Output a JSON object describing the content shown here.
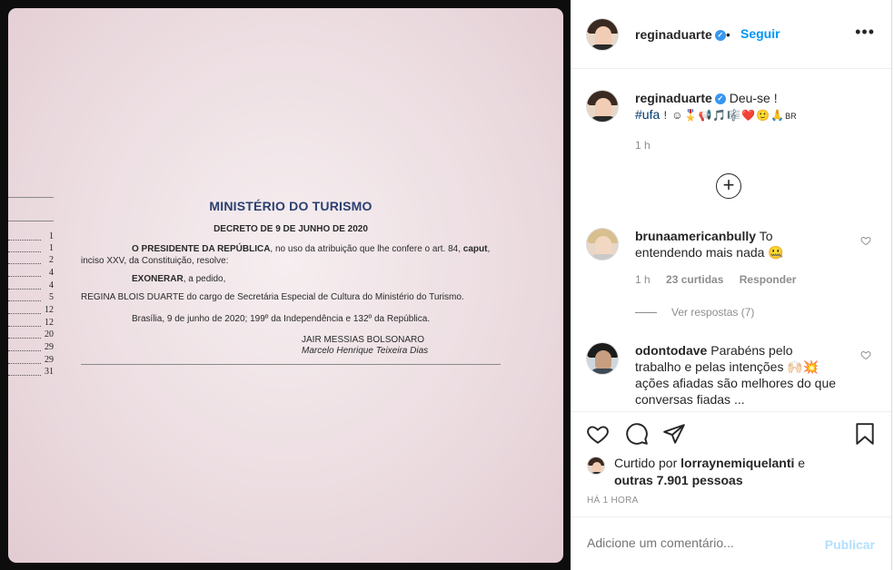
{
  "post": {
    "document": {
      "leader_numbers": [
        "1",
        "1",
        "2",
        "4",
        "4",
        "5",
        "12",
        "12",
        "20",
        "29",
        "29",
        "31"
      ],
      "ministry": "MINISTÉRIO DO TURISMO",
      "decree": "DECRETO DE 9 DE JUNHO DE 2020",
      "para1_bold": "O PRESIDENTE DA REPÚBLICA",
      "para1_rest": ", no uso da atribuição que lhe confere o art. 84,",
      "para1_bold2": "caput",
      "para1_rest2": ", inciso XXV, da Constituição, resolve:",
      "para2_bold": "EXONERAR",
      "para2_rest": ", a pedido,",
      "para3": "REGINA BLOIS DUARTE do cargo de Secretária Especial de Cultura do Ministério do Turismo.",
      "para4": "Brasília, 9 de junho de 2020; 199º da Independência e 132º da República.",
      "signer1": "JAIR MESSIAS BOLSONARO",
      "signer2": "Marcelo Henrique Teixeira Dias"
    }
  },
  "header": {
    "username": "reginaduarte",
    "verified": "✓",
    "separator": "•",
    "follow_label": "Seguir",
    "more_label": "•••"
  },
  "caption": {
    "username": "reginaduarte",
    "text": "Deu-se !",
    "hashtag": "#ufa",
    "rest": " ! ☺🎖️📢🎵🎼❤️🙂🙏",
    "flag": "BR",
    "time": "1 h"
  },
  "comments": [
    {
      "username": "brunaamericanbully",
      "text": "To entendendo mais nada 🤐",
      "time": "1 h",
      "likes": "23 curtidas",
      "reply": "Responder",
      "view_replies": "Ver respostas (7)"
    },
    {
      "username": "odontodave",
      "text": "Parabéns pelo trabalho e pelas intenções 🙌🏻💥 ações afiadas são melhores do que conversas fiadas ..."
    }
  ],
  "likes": {
    "prefix": "Curtido por",
    "user": "lorraynemiquelanti",
    "middle": " e",
    "others": "outras 7.901 pessoas"
  },
  "time_ago": "HÁ 1 HORA",
  "add_comment": {
    "placeholder": "Adicione um comentário...",
    "post_label": "Publicar"
  },
  "colors": {
    "link_blue": "#0095f6",
    "verified_blue": "#3897f0",
    "muted_text": "#8e8e8e",
    "post_disabled": "#b2dffc",
    "ministry_title": "#2b3f70"
  }
}
